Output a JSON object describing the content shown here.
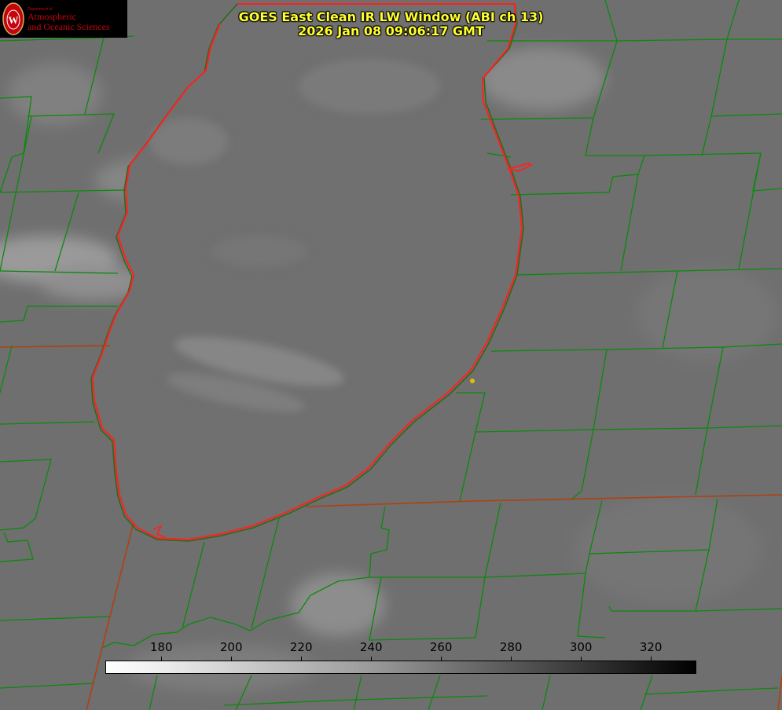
{
  "title": {
    "line1": "GOES East Clean IR LW Window (ABI ch 13)",
    "line2": "2026 Jan 08 09:06:17 GMT"
  },
  "logo": {
    "dept": "Department of",
    "line1": "Atmospheric",
    "line2": "and Oceanic Sciences",
    "icon": "uw-crest-icon"
  },
  "colorbar": {
    "ticks": [
      "180",
      "200",
      "220",
      "240",
      "260",
      "280",
      "300",
      "320"
    ],
    "range": [
      164,
      333
    ],
    "colors": {
      "low": "#ffffff",
      "high": "#000000"
    }
  },
  "map": {
    "colors": {
      "lake_outline": "#ff2020",
      "county_lines": "#0a8a0a",
      "state_lines": "#b04010",
      "station_dot": "#e0c000"
    }
  }
}
